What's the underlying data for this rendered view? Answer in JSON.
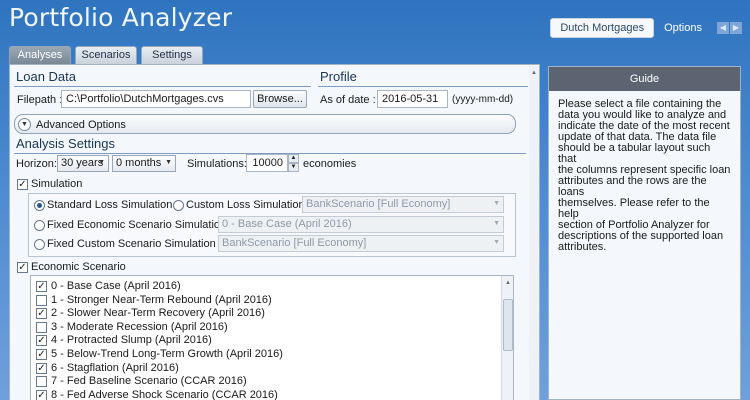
{
  "app": {
    "title": "Portfolio Analyzer",
    "top_button": "Dutch Mortgages",
    "options_label": "Options",
    "prev_icon": "chevron-left",
    "next_icon": "chevron-right"
  },
  "tabs": [
    {
      "label": "Analyses",
      "active": true
    },
    {
      "label": "Scenarios",
      "active": false
    },
    {
      "label": "Settings",
      "active": false
    }
  ],
  "loan_data": {
    "title": "Loan Data",
    "filepath_label": "Filepath :",
    "filepath_value": "C:\\Portfolio\\DutchMortgages.cvs",
    "browse_label": "Browse..."
  },
  "profile": {
    "title": "Profile",
    "as_of_label": "As of date :",
    "as_of_value": "2016-05-31",
    "format_hint": "(yyyy-mm-dd)"
  },
  "advanced_options_label": "Advanced Options",
  "analysis_settings": {
    "title": "Analysis Settings",
    "horizon_label": "Horizon:",
    "horizon_years": "30 years",
    "horizon_months": "0 months",
    "simulations_label": "Simulations:",
    "simulations_value": "10000",
    "economies_label": "economies"
  },
  "simulation": {
    "label": "Simulation",
    "checked": true,
    "options": [
      {
        "label": "Standard Loss Simulation",
        "selected": true
      },
      {
        "label": "Custom Loss Simulation",
        "selected": false,
        "combo": "BankScenario [Full Economy]"
      },
      {
        "label": "Fixed Economic Scenario Simulation",
        "selected": false,
        "combo": "0 - Base Case (April 2016)"
      },
      {
        "label": "Fixed Custom Scenario Simulation",
        "selected": false,
        "combo": "BankScenario [Full Economy]"
      }
    ]
  },
  "economic_scenario": {
    "label": "Economic Scenario",
    "checked": true,
    "items": [
      {
        "label": "0 - Base Case (April 2016)",
        "checked": true
      },
      {
        "label": "1 - Stronger Near-Term Rebound (April 2016)",
        "checked": false
      },
      {
        "label": "2 - Slower Near-Term Recovery (April 2016)",
        "checked": true
      },
      {
        "label": "3 - Moderate Recession (April 2016)",
        "checked": false
      },
      {
        "label": "4 - Protracted Slump (April 2016)",
        "checked": true
      },
      {
        "label": "5 - Below-Trend Long-Term Growth (April 2016)",
        "checked": true
      },
      {
        "label": "6 - Stagflation (April 2016)",
        "checked": true
      },
      {
        "label": "7 - Fed Baseline Scenario (CCAR 2016)",
        "checked": false
      },
      {
        "label": "8 - Fed Adverse Shock Scenario (CCAR 2016)",
        "checked": true
      }
    ]
  },
  "guide": {
    "title": "Guide",
    "lines": [
      "Please select a file containing the",
      "data you would like to analyze and",
      "indicate the date of the most recent",
      "update of that data. The data file",
      "should be a tabular layout such that",
      "the columns represent specific loan",
      "attributes and the rows are the loans",
      "themselves. Please refer to the help",
      "section of Portfolio Analyzer for",
      "descriptions of the supported loan",
      "attributes."
    ]
  }
}
